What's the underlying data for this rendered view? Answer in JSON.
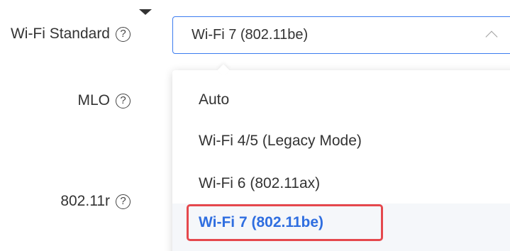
{
  "form": {
    "wifi_standard": {
      "label": "Wi-Fi Standard",
      "help_glyph": "?",
      "value": "Wi-Fi 7 (802.11be)"
    },
    "mlo": {
      "label": "MLO",
      "help_glyph": "?"
    },
    "r80211": {
      "label": "802.11r",
      "help_glyph": "?"
    }
  },
  "dropdown": {
    "options": [
      "Auto",
      "Wi-Fi 4/5 (Legacy Mode)",
      "Wi-Fi 6 (802.11ax)",
      "Wi-Fi 7 (802.11be)"
    ],
    "selected_index": 3
  },
  "colors": {
    "accent": "#3c7cf0",
    "selected_text": "#2f6ee0",
    "annotation_box": "#e5484d"
  },
  "icons": {
    "help": "help-circle-icon",
    "chevron": "chevron-up-icon",
    "cursor": "caret-down-icon"
  }
}
